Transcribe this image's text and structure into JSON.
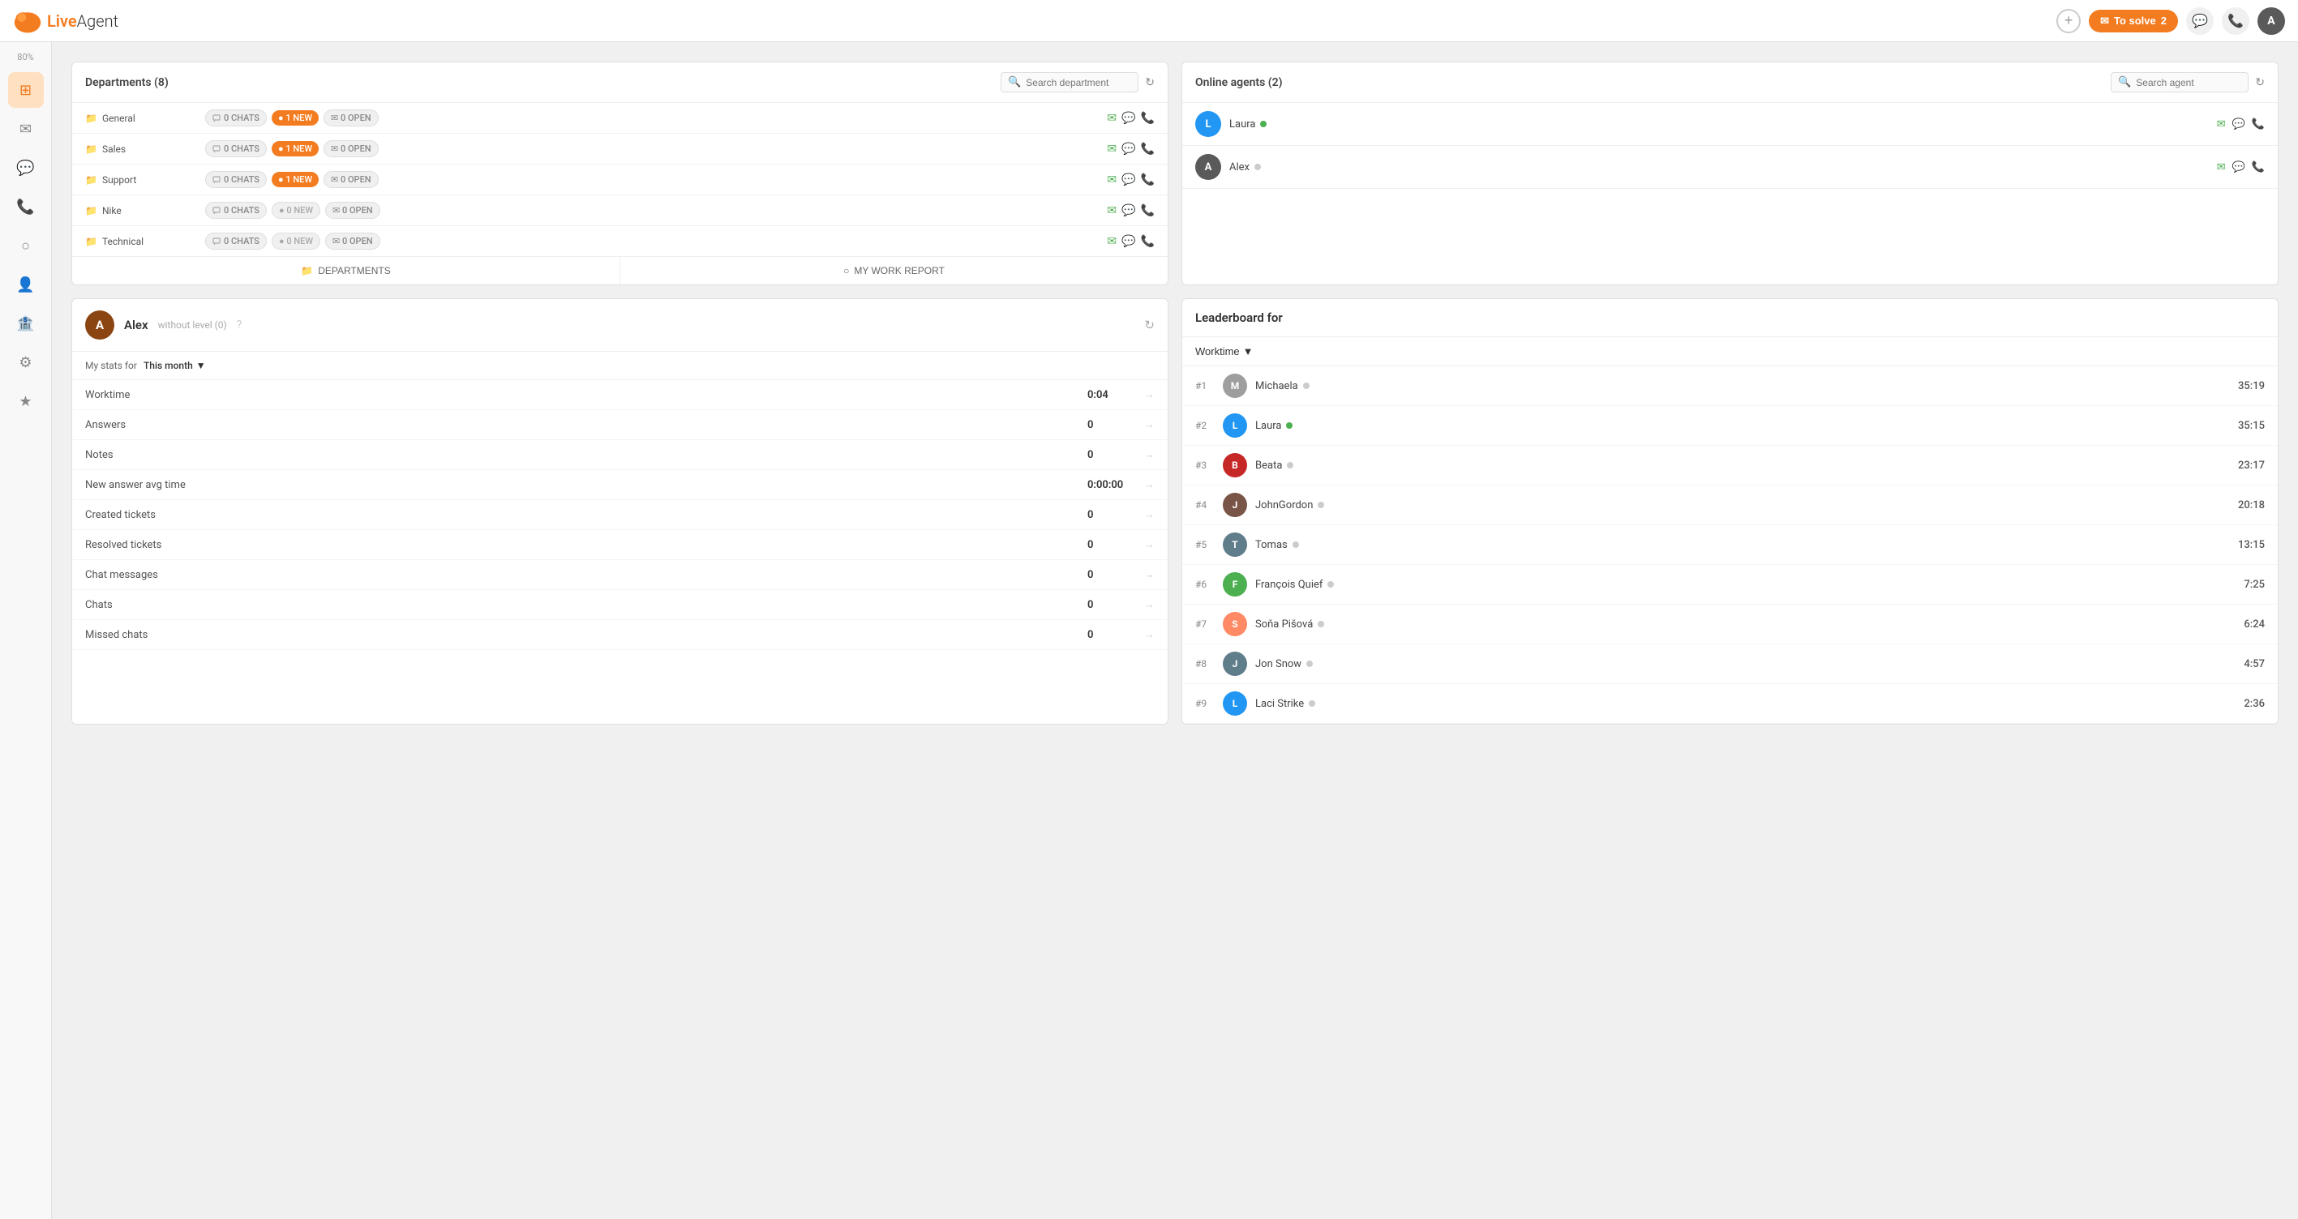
{
  "topnav": {
    "logo_text_live": "Live",
    "logo_text_agent": "Agent",
    "tosolve_label": "To solve",
    "tosolve_count": "2",
    "avatar_label": "A"
  },
  "sidebar": {
    "percent": "80%",
    "items": [
      {
        "label": "Dashboard",
        "icon": "⊞",
        "active": true
      },
      {
        "label": "Email",
        "icon": "✉"
      },
      {
        "label": "Chat",
        "icon": "💬"
      },
      {
        "label": "Call",
        "icon": "📞"
      },
      {
        "label": "Reports",
        "icon": "○"
      },
      {
        "label": "Contacts",
        "icon": "👤"
      },
      {
        "label": "Bank",
        "icon": "🏦"
      },
      {
        "label": "Settings",
        "icon": "⚙"
      },
      {
        "label": "Plugin",
        "icon": "★"
      }
    ]
  },
  "departments": {
    "title": "Departments (8)",
    "search_placeholder": "Search department",
    "rows": [
      {
        "name": "General",
        "chats": "0 CHATS",
        "new_count": "1 NEW",
        "new_active": true,
        "open": "0 OPEN"
      },
      {
        "name": "Sales",
        "chats": "0 CHATS",
        "new_count": "1 NEW",
        "new_active": true,
        "open": "0 OPEN"
      },
      {
        "name": "Support",
        "chats": "0 CHATS",
        "new_count": "1 NEW",
        "new_active": true,
        "open": "0 OPEN"
      },
      {
        "name": "Nike",
        "chats": "0 CHATS",
        "new_count": "0 NEW",
        "new_active": false,
        "open": "0 OPEN"
      },
      {
        "name": "Technical",
        "chats": "0 CHATS",
        "new_count": "0 NEW",
        "new_active": false,
        "open": "0 OPEN"
      }
    ],
    "footer_left": "DEPARTMENTS",
    "footer_right": "MY WORK REPORT"
  },
  "online_agents": {
    "title": "Online agents (2)",
    "search_placeholder": "Search agent",
    "agents": [
      {
        "name": "Laura",
        "initial": "L",
        "color": "#2196F3",
        "online": true
      },
      {
        "name": "Alex",
        "initial": "A",
        "color": "#5a5a5a",
        "online": false
      }
    ]
  },
  "stats": {
    "avatar_initial": "A",
    "username": "Alex",
    "level": "without level (0)",
    "filter_label": "My stats for",
    "period": "This month",
    "rows": [
      {
        "label": "Worktime",
        "value": "0:04"
      },
      {
        "label": "Answers",
        "value": "0"
      },
      {
        "label": "Notes",
        "value": "0"
      },
      {
        "label": "New answer avg time",
        "value": "0:00:00"
      },
      {
        "label": "Created tickets",
        "value": "0"
      },
      {
        "label": "Resolved tickets",
        "value": "0"
      },
      {
        "label": "Chat messages",
        "value": "0"
      },
      {
        "label": "Chats",
        "value": "0"
      },
      {
        "label": "Missed chats",
        "value": "0"
      }
    ]
  },
  "leaderboard": {
    "title": "Leaderboard for",
    "filter": "Worktime",
    "entries": [
      {
        "rank": "#1",
        "name": "Michaela",
        "online": false,
        "time": "35:19",
        "initial": "M",
        "color": "#9e9e9e",
        "avatar_type": "initial"
      },
      {
        "rank": "#2",
        "name": "Laura",
        "online": true,
        "time": "35:15",
        "initial": "L",
        "color": "#2196F3",
        "avatar_type": "initial"
      },
      {
        "rank": "#3",
        "name": "Beata",
        "online": false,
        "time": "23:17",
        "initial": "B",
        "color": "#c62828",
        "avatar_type": "initial"
      },
      {
        "rank": "#4",
        "name": "JohnGordon",
        "online": false,
        "time": "20:18",
        "initial": "J",
        "color": "#795548",
        "avatar_type": "photo"
      },
      {
        "rank": "#5",
        "name": "Tomas",
        "online": false,
        "time": "13:15",
        "initial": "T",
        "color": "#607d8b",
        "avatar_type": "photo"
      },
      {
        "rank": "#6",
        "name": "François Quief",
        "online": false,
        "time": "7:25",
        "initial": "F",
        "color": "#4caf50",
        "avatar_type": "initial"
      },
      {
        "rank": "#7",
        "name": "Soňa Pišová",
        "online": false,
        "time": "6:24",
        "initial": "S",
        "color": "#ff8a65",
        "avatar_type": "photo"
      },
      {
        "rank": "#8",
        "name": "Jon Snow",
        "online": false,
        "time": "4:57",
        "initial": "J",
        "color": "#607d8b",
        "avatar_type": "photo"
      },
      {
        "rank": "#9",
        "name": "Laci Strike",
        "online": false,
        "time": "2:36",
        "initial": "L",
        "color": "#2196F3",
        "avatar_type": "initial"
      }
    ]
  }
}
